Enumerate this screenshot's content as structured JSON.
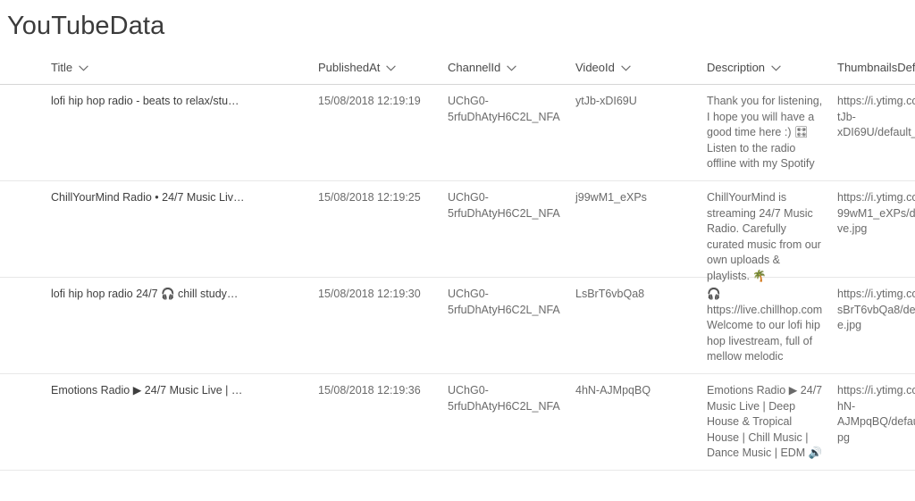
{
  "header": {
    "title": "YouTubeData"
  },
  "table": {
    "sort_icon": "chevron-down-icon",
    "columns": [
      {
        "key": "title",
        "label": "Title",
        "sortable": true
      },
      {
        "key": "publishedAt",
        "label": "PublishedAt",
        "sortable": true
      },
      {
        "key": "channelId",
        "label": "ChannelId",
        "sortable": true
      },
      {
        "key": "videoId",
        "label": "VideoId",
        "sortable": true
      },
      {
        "key": "description",
        "label": "Description",
        "sortable": true
      },
      {
        "key": "thumbnails",
        "label": "ThumbnailsDefa",
        "sortable": false
      }
    ],
    "rows": [
      {
        "title": "lofi hip hop radio - beats to relax/stu…",
        "publishedAt": "15/08/2018 12:19:19",
        "channelId": "UChG0-5rfuDhAtyH6C2L_NFA",
        "videoId": "ytJb-xDI69U",
        "description": "Thank you for listening, I hope you will have a good time here :) 🎛 Listen to the radio offline with my Spotify",
        "thumbnails": "https://i.ytimg.co tJb-xDI69U/default_"
      },
      {
        "title": "ChillYourMind Radio • 24/7 Music Liv…",
        "publishedAt": "15/08/2018 12:19:25",
        "channelId": "UChG0-5rfuDhAtyH6C2L_NFA",
        "videoId": "j99wM1_eXPs",
        "description": "ChillYourMind is streaming 24/7 Music Radio. Carefully curated music from our own uploads & playlists. 🌴",
        "thumbnails": "https://i.ytimg.co 99wM1_eXPs/de ve.jpg"
      },
      {
        "title": "lofi hip hop radio 24/7 🎧 chill study…",
        "publishedAt": "15/08/2018 12:19:30",
        "channelId": "UChG0-5rfuDhAtyH6C2L_NFA",
        "videoId": "LsBrT6vbQa8",
        "description": "🎧\nhttps://live.chillhop.com Welcome to our lofi hip hop livestream, full of mellow melodic",
        "thumbnails": "https://i.ytimg.co sBrT6vbQa8/def e.jpg"
      },
      {
        "title": "Emotions Radio ▶ 24/7 Music Live | …",
        "publishedAt": "15/08/2018 12:19:36",
        "channelId": "UChG0-5rfuDhAtyH6C2L_NFA",
        "videoId": "4hN-AJMpqBQ",
        "description": "Emotions Radio ▶ 24/7 Music Live | Deep House & Tropical House | Chill Music | Dance Music | EDM 🔊",
        "thumbnails": "https://i.ytimg.co hN-AJMpqBQ/defau pg"
      }
    ]
  },
  "colors": {
    "title_text": "#3b3b3b",
    "header_text": "#4a4a4a",
    "cell_text": "#6a6a6a",
    "divider": "#e8e8e8",
    "header_divider": "#d6d6d6",
    "background": "#ffffff"
  }
}
